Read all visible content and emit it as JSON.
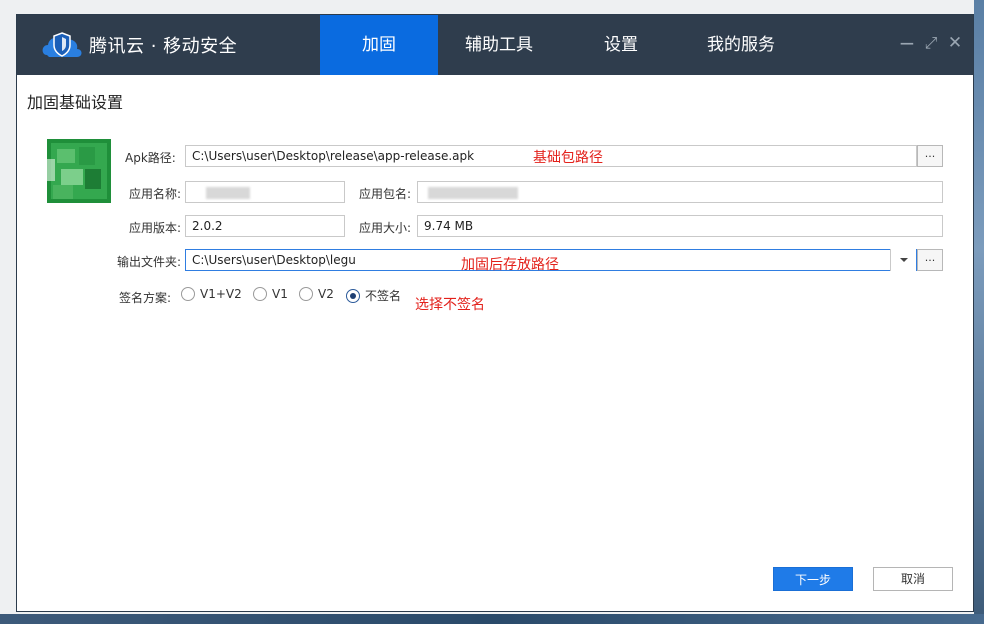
{
  "app": {
    "title": "腾讯云 · 移动安全",
    "brand_color": "#0a6be0",
    "titlebar_color": "#2f3d4d"
  },
  "tabs": [
    {
      "label": "加固",
      "active": true
    },
    {
      "label": "辅助工具",
      "active": false
    },
    {
      "label": "设置",
      "active": false
    },
    {
      "label": "我的服务",
      "active": false
    }
  ],
  "window_controls": {
    "minimize": "−",
    "maximize": "⤢",
    "close": "✕"
  },
  "page": {
    "section_title": "加固基础设置"
  },
  "form": {
    "apk_path_label": "Apk路径:",
    "apk_path_value": "C:\\Users\\user\\Desktop\\release\\app-release.apk",
    "app_name_label": "应用名称:",
    "package_name_label": "应用包名:",
    "version_label": "应用版本:",
    "version_value": "2.0.2",
    "size_label": "应用大小:",
    "size_value": "9.74 MB",
    "output_label": "输出文件夹:",
    "output_value": "C:\\Users\\user\\Desktop\\legu",
    "browse_label": "...",
    "sign_label": "签名方案:",
    "sign_options": [
      {
        "label": "V1+V2",
        "checked": false
      },
      {
        "label": "V1",
        "checked": false
      },
      {
        "label": "V2",
        "checked": false
      },
      {
        "label": "不签名",
        "checked": true
      }
    ]
  },
  "annotations": {
    "apk": "基础包路径",
    "output": "加固后存放路径",
    "sign": "选择不签名",
    "color": "#e3211b"
  },
  "buttons": {
    "next": "下一步",
    "cancel": "取消"
  }
}
